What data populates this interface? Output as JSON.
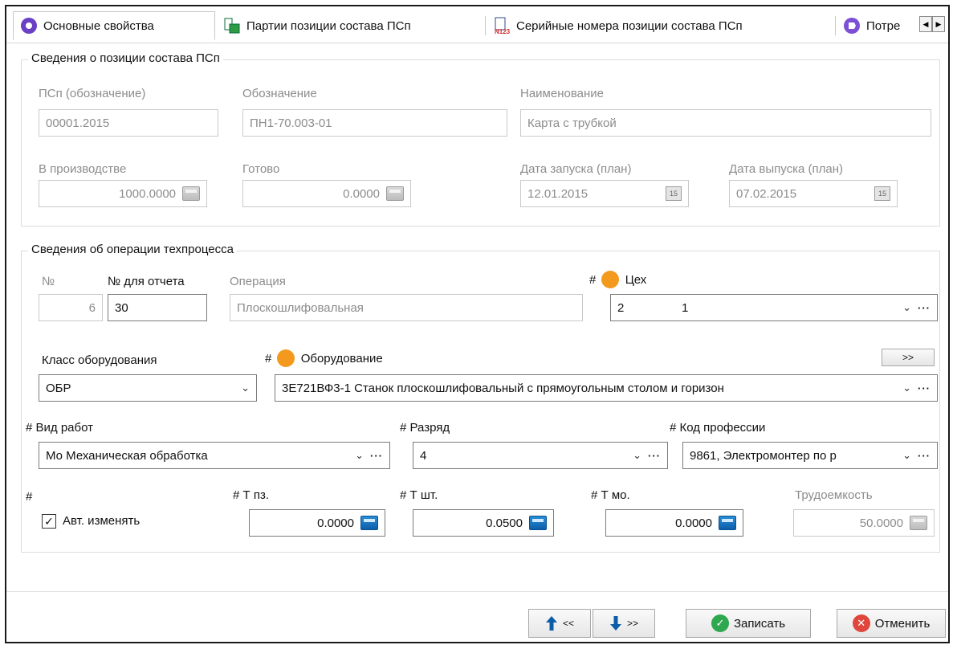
{
  "tabs": [
    {
      "label": "Основные свойства",
      "icon": "purple-circle-icon"
    },
    {
      "label": "Партии позиции состава ПСп",
      "icon": "batch-icon"
    },
    {
      "label": "Серийные номера позиции состава ПСп",
      "icon": "serial-number-icon"
    },
    {
      "label": "Потре",
      "icon": "purple-tag-icon"
    }
  ],
  "position_group": {
    "title": "Сведения о позиции состава ПСп",
    "psp_label": "ПСп (обозначение)",
    "psp_value": "00001.2015",
    "designation_label": "Обозначение",
    "designation_value": "ПН1-70.003-01",
    "name_label": "Наименование",
    "name_value": "Карта с трубкой",
    "in_production_label": "В производстве",
    "in_production_value": "1000.0000",
    "ready_label": "Готово",
    "ready_value": "0.0000",
    "start_date_label": "Дата запуска (план)",
    "start_date_value": "12.01.2015",
    "release_date_label": "Дата выпуска (план)",
    "release_date_value": "07.02.2015",
    "calendar_glyph": "15"
  },
  "operation_group": {
    "title": "Сведения об операции техпроцесса",
    "num_label": "№",
    "num_value": "6",
    "report_num_label": "№ для отчета",
    "report_num_value": "30",
    "operation_label": "Операция",
    "operation_value": "Плоскошлифовальная",
    "workshop_label": "Цех",
    "workshop_code": "2",
    "workshop_value": "1",
    "equipment_class_label": "Класс оборудования",
    "equipment_class_value": "ОБР",
    "equipment_label": "Оборудование",
    "equipment_value": "3Е721ВФ3-1  Станок плоскошлифовальный с прямоугольным столом и горизон",
    "equipment_more": ">>",
    "work_type_label": "Вид работ",
    "work_type_value": "Мо  Механическая обработка",
    "grade_label": "Разряд",
    "grade_value": "4",
    "profession_label": "Код профессии",
    "profession_value": "9861, Электромонтер по р",
    "auto_change_label": "Авт. изменять",
    "auto_change_checked": true,
    "t_pz_label": "Т пз.",
    "t_pz_value": "0.0000",
    "t_sht_label": "Т шт.",
    "t_sht_value": "0.0500",
    "t_mo_label": "Т мо.",
    "t_mo_value": "0.0000",
    "labor_label": "Трудоемкость",
    "labor_value": "50.0000",
    "hash": "#"
  },
  "footer": {
    "prev_label": "<<",
    "next_label": ">>",
    "save_label": "Записать",
    "cancel_label": "Отменить"
  },
  "colors": {
    "accent_blue": "#0c5da8",
    "save_green": "#2fa84f",
    "cancel_red": "#e0473c",
    "tab_purple": "#6b3fc6",
    "workshop_orange": "#f39a1e"
  }
}
